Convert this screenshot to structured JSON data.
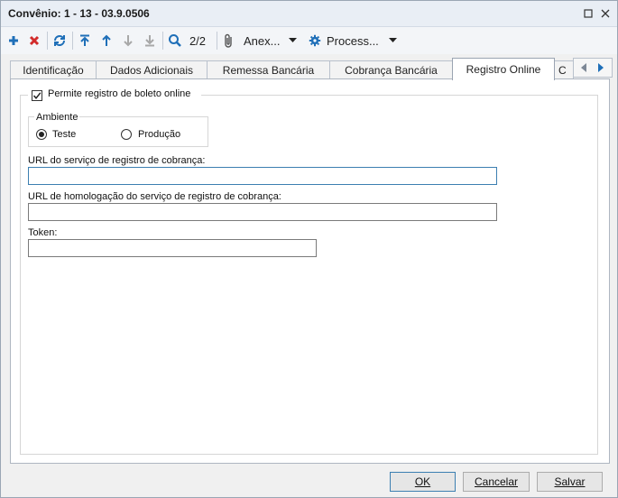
{
  "window": {
    "title": "Convênio: 1 - 13 - 03.9.0506"
  },
  "toolbar": {
    "page_counter": "2/2",
    "attachments_label": "Anex...",
    "process_label": "Process..."
  },
  "tabs": [
    {
      "label": "Identificação"
    },
    {
      "label": "Dados Adicionais"
    },
    {
      "label": "Remessa Bancária"
    },
    {
      "label": "Cobrança Bancária"
    },
    {
      "label": "Registro Online"
    },
    {
      "label": "C"
    }
  ],
  "online": {
    "permit_label": "Permite registro de boleto online",
    "permit_checked": true,
    "environment": {
      "legend": "Ambiente",
      "options": [
        "Teste",
        "Produção"
      ],
      "selected": "Teste"
    },
    "url_label": "URL do serviço de registro de cobrança:",
    "url_value": "",
    "homolog_label": "URL de homologação do serviço de registro de cobrança:",
    "homolog_value": "",
    "token_label": "Token:",
    "token_value": ""
  },
  "footer": {
    "ok": "OK",
    "cancel": "Cancelar",
    "save": "Salvar"
  },
  "colors": {
    "accent": "#1f6fb8",
    "delete": "#d22b2b",
    "focus": "#3c7fb1"
  }
}
